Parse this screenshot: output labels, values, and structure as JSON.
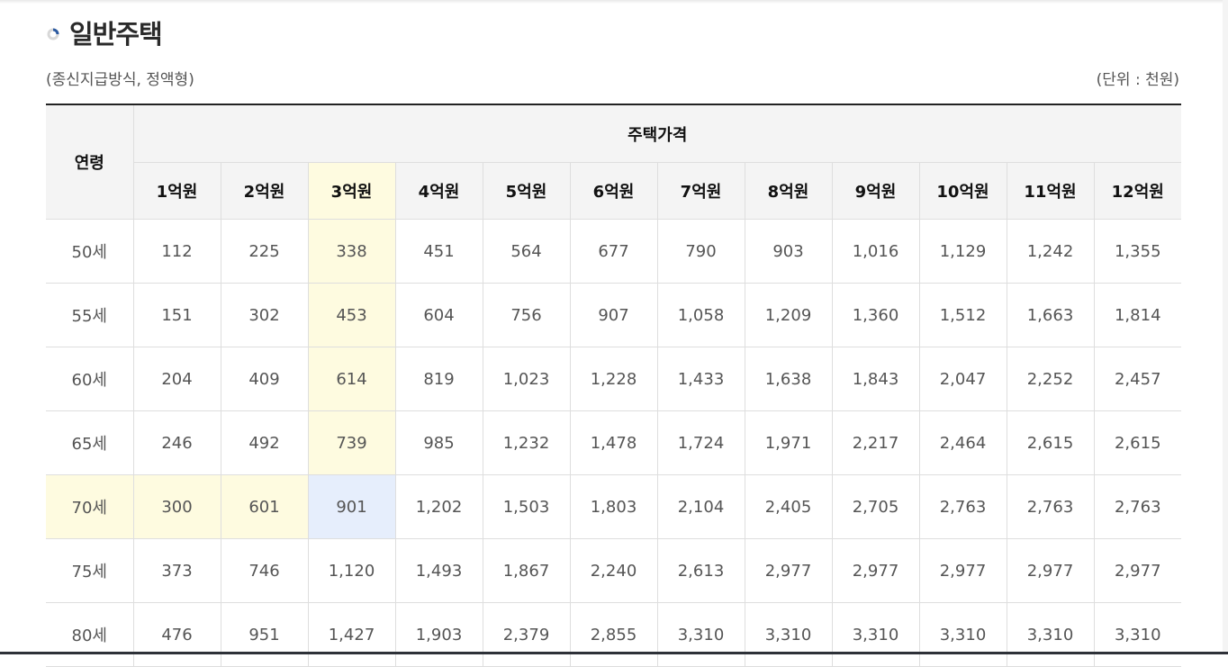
{
  "section": {
    "title": "일반주택",
    "subtitle": "(종신지급방식, 정액형)",
    "unit": "(단위 : 천원)"
  },
  "colors": {
    "highlight_yellow": "#fefbe0",
    "highlight_blue": "#e6eefc",
    "bullet_accent": "#2c5aa0"
  },
  "table": {
    "age_header": "연령",
    "group_header": "주택가격",
    "price_headers": [
      "1억원",
      "2억원",
      "3억원",
      "4억원",
      "5억원",
      "6억원",
      "7억원",
      "8억원",
      "9억원",
      "10억원",
      "11억원",
      "12억원"
    ],
    "rows": [
      {
        "age": "50세",
        "values": [
          "112",
          "225",
          "338",
          "451",
          "564",
          "677",
          "790",
          "903",
          "1,016",
          "1,129",
          "1,242",
          "1,355"
        ]
      },
      {
        "age": "55세",
        "values": [
          "151",
          "302",
          "453",
          "604",
          "756",
          "907",
          "1,058",
          "1,209",
          "1,360",
          "1,512",
          "1,663",
          "1,814"
        ]
      },
      {
        "age": "60세",
        "values": [
          "204",
          "409",
          "614",
          "819",
          "1,023",
          "1,228",
          "1,433",
          "1,638",
          "1,843",
          "2,047",
          "2,252",
          "2,457"
        ]
      },
      {
        "age": "65세",
        "values": [
          "246",
          "492",
          "739",
          "985",
          "1,232",
          "1,478",
          "1,724",
          "1,971",
          "2,217",
          "2,464",
          "2,615",
          "2,615"
        ]
      },
      {
        "age": "70세",
        "values": [
          "300",
          "601",
          "901",
          "1,202",
          "1,503",
          "1,803",
          "2,104",
          "2,405",
          "2,705",
          "2,763",
          "2,763",
          "2,763"
        ]
      },
      {
        "age": "75세",
        "values": [
          "373",
          "746",
          "1,120",
          "1,493",
          "1,867",
          "2,240",
          "2,613",
          "2,977",
          "2,977",
          "2,977",
          "2,977",
          "2,977"
        ]
      },
      {
        "age": "80세",
        "values": [
          "476",
          "951",
          "1,427",
          "1,903",
          "2,379",
          "2,855",
          "3,310",
          "3,310",
          "3,310",
          "3,310",
          "3,310",
          "3,310"
        ]
      }
    ]
  }
}
